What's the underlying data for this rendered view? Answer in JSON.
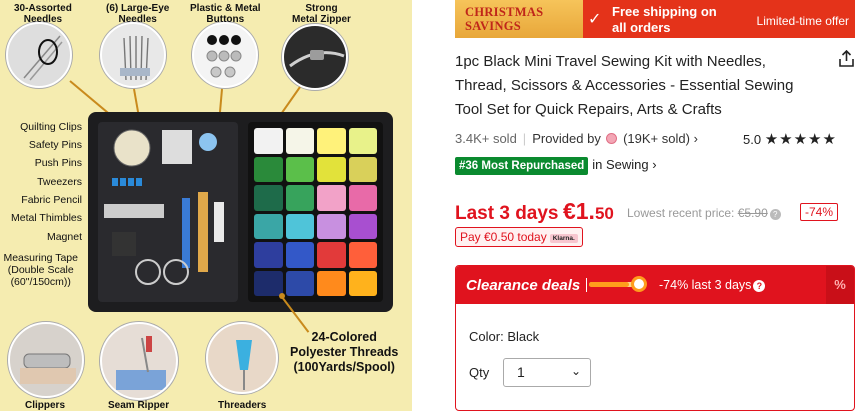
{
  "product_image": {
    "labels": {
      "assorted_needles": "30-Assorted\nNeedles",
      "large_eye_needles": "(6) Large-Eye\nNeedles",
      "buttons": "Plastic & Metal\nButtons",
      "zipper": "Strong\nMetal Zipper",
      "quilting_clips": "Quilting Clips",
      "safety_pins": "Safety Pins",
      "push_pins": "Push Pins",
      "tweezers": "Tweezers",
      "fabric_pencil": "Fabric Pencil",
      "metal_thimbles": "Metal Thimbles",
      "magnet": "Magnet",
      "measuring_tape": "Measuring Tape\n(Double Scale\n(60\"/150cm))",
      "threads": "24-Colored\nPolyester Threads\n(100Yards/Spool)",
      "clippers": "Clippers",
      "seam_ripper": "Seam Ripper",
      "threaders": "Threaders"
    },
    "thread_colors": [
      "#f2f2f2",
      "#f5f5e8",
      "#fff27a",
      "#e8f28a",
      "#2a8a3a",
      "#5bbf4a",
      "#e2e23a",
      "#d9d05a",
      "#1e6b4a",
      "#37a35c",
      "#f2a2c8",
      "#e86aa8",
      "#3aa6a6",
      "#4fc4d9",
      "#c890e0",
      "#a84fd0",
      "#2e3e9e",
      "#3358c8",
      "#e23a3a",
      "#ff5f3a",
      "#1d2c6b",
      "#2d4aa8",
      "#ff8a1c",
      "#ffb21c"
    ]
  },
  "banner": {
    "christmas": "CHRISTMAS\nSAVINGS",
    "check_icon": "check-icon",
    "shipping": "Free shipping on\nall orders",
    "limited": "Limited-time offer"
  },
  "product": {
    "title": "1pc Black Mini Travel Sewing Kit with Needles, Thread, Scissors & Accessories - Essential Sewing Tool Set for Quick Repairs, Arts & Crafts",
    "sold": "3.4K+ sold",
    "provided_by": "Provided by",
    "seller_sold": "(19K+ sold)",
    "rating": "5.0",
    "stars": "★★★★★",
    "rank_badge": "#36 Most Repurchased",
    "rank_category": "in Sewing",
    "price_label": "Last 3 days",
    "price_main": "€1.",
    "price_cents": "50",
    "lowest_label": "Lowest recent price:",
    "lowest_price": "€5.90",
    "discount": "-74%",
    "pay_today": "Pay €0.50 today",
    "klarna": "Klarna."
  },
  "clearance": {
    "title": "Clearance deals",
    "progress_fraction": 0.8,
    "detail": "-74% last 3 days",
    "color_label": "Color:",
    "color_value": "Black",
    "qty_label": "Qty",
    "qty_value": "1"
  },
  "colors": {
    "accent_red": "#e0131e",
    "banner_red": "#e4331a",
    "badge_green": "#0a8a2f",
    "image_bg": "#f5ecb0"
  }
}
